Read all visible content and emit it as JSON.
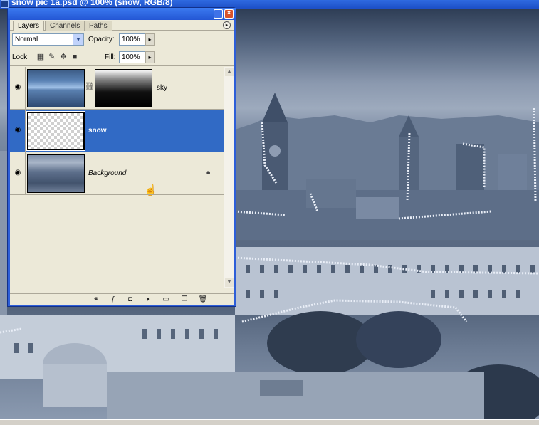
{
  "document": {
    "title": "snow pic 1a.psd @ 100% (snow, RGB/8)"
  },
  "palette": {
    "tabs": [
      {
        "label": "Layers",
        "active": true
      },
      {
        "label": "Channels",
        "active": false
      },
      {
        "label": "Paths",
        "active": false
      }
    ],
    "blend_mode": "Normal",
    "opacity_label": "Opacity:",
    "opacity_value": "100%",
    "lock_label": "Lock:",
    "fill_label": "Fill:",
    "fill_value": "100%",
    "layers": [
      {
        "name": "sky",
        "visible": true,
        "has_mask": true,
        "selected": false
      },
      {
        "name": "snow",
        "visible": true,
        "has_mask": false,
        "selected": true
      },
      {
        "name": "Background",
        "visible": true,
        "has_mask": false,
        "selected": false,
        "locked": true
      }
    ]
  },
  "colors": {
    "titlebar_blue": "#2356d4",
    "selection_blue": "#316ac5",
    "palette_bg": "#ece9d8",
    "close_red": "#d9532b"
  },
  "icons": [
    "eye-icon",
    "chain-icon",
    "lock-icon",
    "link-layers-icon",
    "layer-style-icon",
    "layer-mask-icon",
    "adjustment-layer-icon",
    "new-group-icon",
    "new-layer-icon",
    "trash-icon"
  ]
}
